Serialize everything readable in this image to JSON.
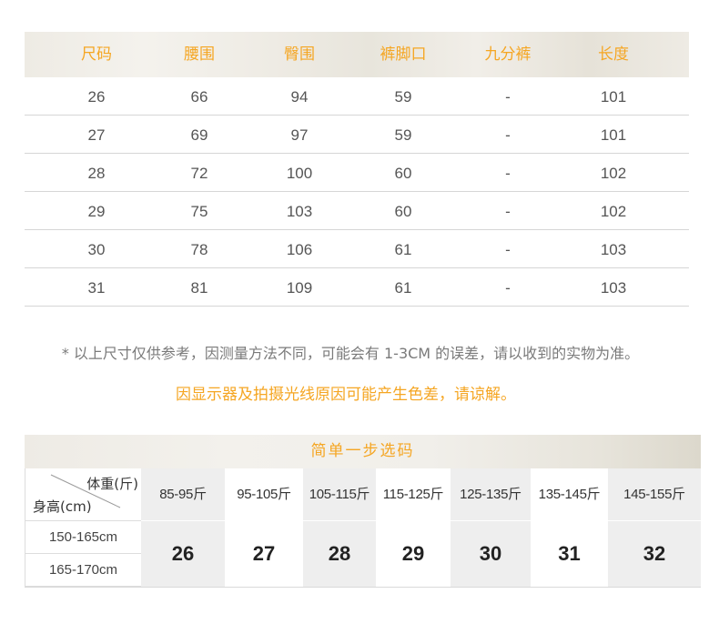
{
  "colors": {
    "accent": "#f5a623",
    "cell_shade": "#eeeeee"
  },
  "size_chart": {
    "headers": [
      "尺码",
      "腰围",
      "臀围",
      "裤脚口",
      "九分裤",
      "长度"
    ],
    "rows": [
      [
        "26",
        "66",
        "94",
        "59",
        "-",
        "101"
      ],
      [
        "27",
        "69",
        "97",
        "59",
        "-",
        "101"
      ],
      [
        "28",
        "72",
        "100",
        "60",
        "-",
        "102"
      ],
      [
        "29",
        "75",
        "103",
        "60",
        "-",
        "102"
      ],
      [
        "30",
        "78",
        "106",
        "61",
        "-",
        "103"
      ],
      [
        "31",
        "81",
        "109",
        "61",
        "-",
        "103"
      ]
    ]
  },
  "notes": {
    "disclaimer": "* 以上尺寸仅供参考，因测量方法不同，可能会有 1-3CM 的误差，请以收到的实物为准。",
    "color_notice": "因显示器及拍摄光线原因可能产生色差，请谅解。"
  },
  "quick_select": {
    "title": "简单一步选码",
    "weight_label": "体重(斤)",
    "height_label": "身高(cm)",
    "weights": [
      "85-95斤",
      "95-105斤",
      "105-115斤",
      "115-125斤",
      "125-135斤",
      "135-145斤",
      "145-155斤"
    ],
    "heights": [
      "150-165cm",
      "165-170cm"
    ],
    "sizes": [
      "26",
      "27",
      "28",
      "29",
      "30",
      "31",
      "32"
    ]
  }
}
